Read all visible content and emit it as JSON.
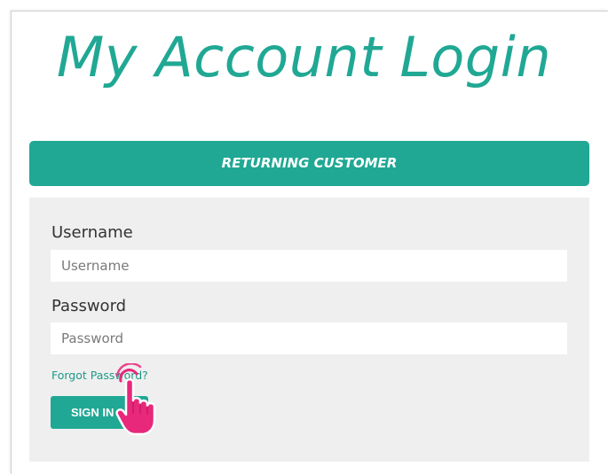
{
  "page": {
    "title": "My Account Login"
  },
  "section": {
    "banner_label": "RETURNING CUSTOMER"
  },
  "form": {
    "username_label": "Username",
    "username_placeholder": "Username",
    "username_value": "",
    "password_label": "Password",
    "password_placeholder": "Password",
    "password_value": "",
    "forgot_link": "Forgot Password?",
    "signin_label": "SIGN IN"
  },
  "colors": {
    "accent": "#20a894",
    "panel_bg": "#efefef",
    "pointer": "#e8287a"
  },
  "icons": {
    "pointer": "hand-pointer-icon"
  }
}
